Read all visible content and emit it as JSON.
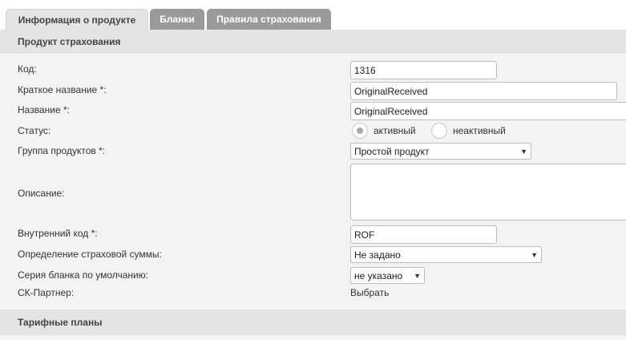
{
  "tabs": [
    {
      "label": "Информация о продукте",
      "active": true
    },
    {
      "label": "Бланки",
      "active": false
    },
    {
      "label": "Правила страхования",
      "active": false
    }
  ],
  "sections": {
    "product": "Продукт страхования",
    "tariff": "Тарифные планы"
  },
  "form": {
    "code": {
      "label": "Код:",
      "value": "1316"
    },
    "short_name": {
      "label": "Краткое название *:",
      "value": "OriginalReceived"
    },
    "name": {
      "label": "Название *:",
      "value": "OriginalReceived"
    },
    "status": {
      "label": "Статус:",
      "options": [
        "активный",
        "неактивный"
      ],
      "selected": "активный"
    },
    "product_group": {
      "label": "Группа продуктов *:",
      "value": "Простой продукт"
    },
    "description": {
      "label": "Описание:",
      "value": ""
    },
    "internal_code": {
      "label": "Внутренний код *:",
      "value": "ROF"
    },
    "sum_definition": {
      "label": "Определение страховой суммы:",
      "value": "Не задано"
    },
    "default_series": {
      "label": "Серия бланка по умолчанию:",
      "value": "не указано"
    },
    "sk_partner": {
      "label": "СК-Партнер:",
      "link": "Выбрать"
    }
  },
  "icons": {
    "dropdown_caret": "▼"
  }
}
